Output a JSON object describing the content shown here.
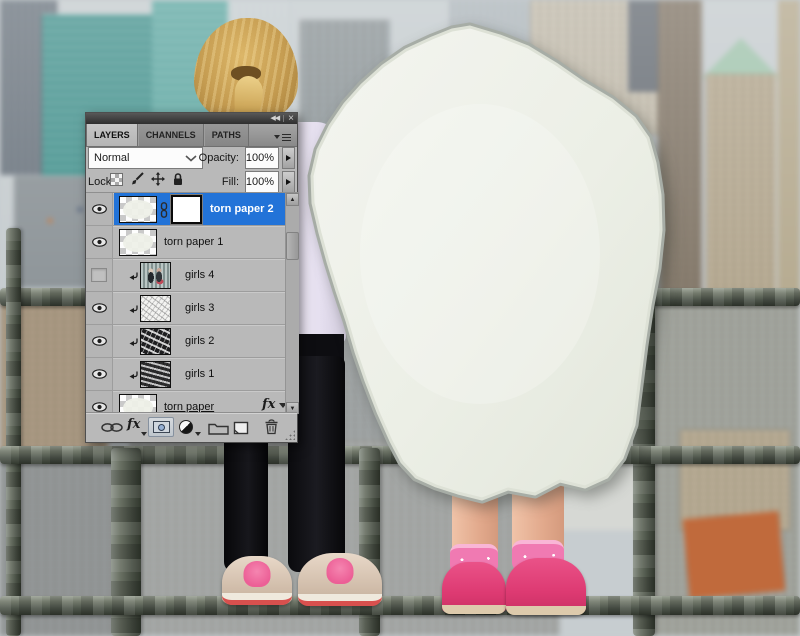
{
  "window": {
    "collapse_icon": "◀◀",
    "close_icon": "×"
  },
  "tabs": [
    {
      "label": "LAYERS",
      "active": true
    },
    {
      "label": "CHANNELS",
      "active": false
    },
    {
      "label": "PATHS",
      "active": false
    }
  ],
  "controls": {
    "blend_mode": "Normal",
    "opacity_label": "Opacity:",
    "opacity_value": "100%",
    "lock_label": "Lock:",
    "fill_label": "Fill:",
    "fill_value": "100%"
  },
  "layers": [
    {
      "name": "torn paper 2",
      "visible": true,
      "selected": true,
      "has_mask": true
    },
    {
      "name": "torn paper 1",
      "visible": true
    },
    {
      "name": "girls 4",
      "visible": false,
      "clipped": true
    },
    {
      "name": "girls 3",
      "visible": true,
      "clipped": true
    },
    {
      "name": "girls 2",
      "visible": true,
      "clipped": true
    },
    {
      "name": "girls 1",
      "visible": true,
      "clipped": true
    },
    {
      "name": "torn paper",
      "visible": true,
      "has_style": true,
      "fx_label": "fx"
    }
  ],
  "footer": {
    "fx_label": "fx"
  },
  "scrollbar": {
    "up": "▲",
    "down": "▼"
  },
  "colors": {
    "selection_blue": "#2273d8",
    "panel_gray": "#b9b9b9",
    "paper_cream": "#eef0e8",
    "railing_green_gray": "#5c6457",
    "shoe_pink": "#e8538a",
    "teal_building": "#4a968f"
  }
}
